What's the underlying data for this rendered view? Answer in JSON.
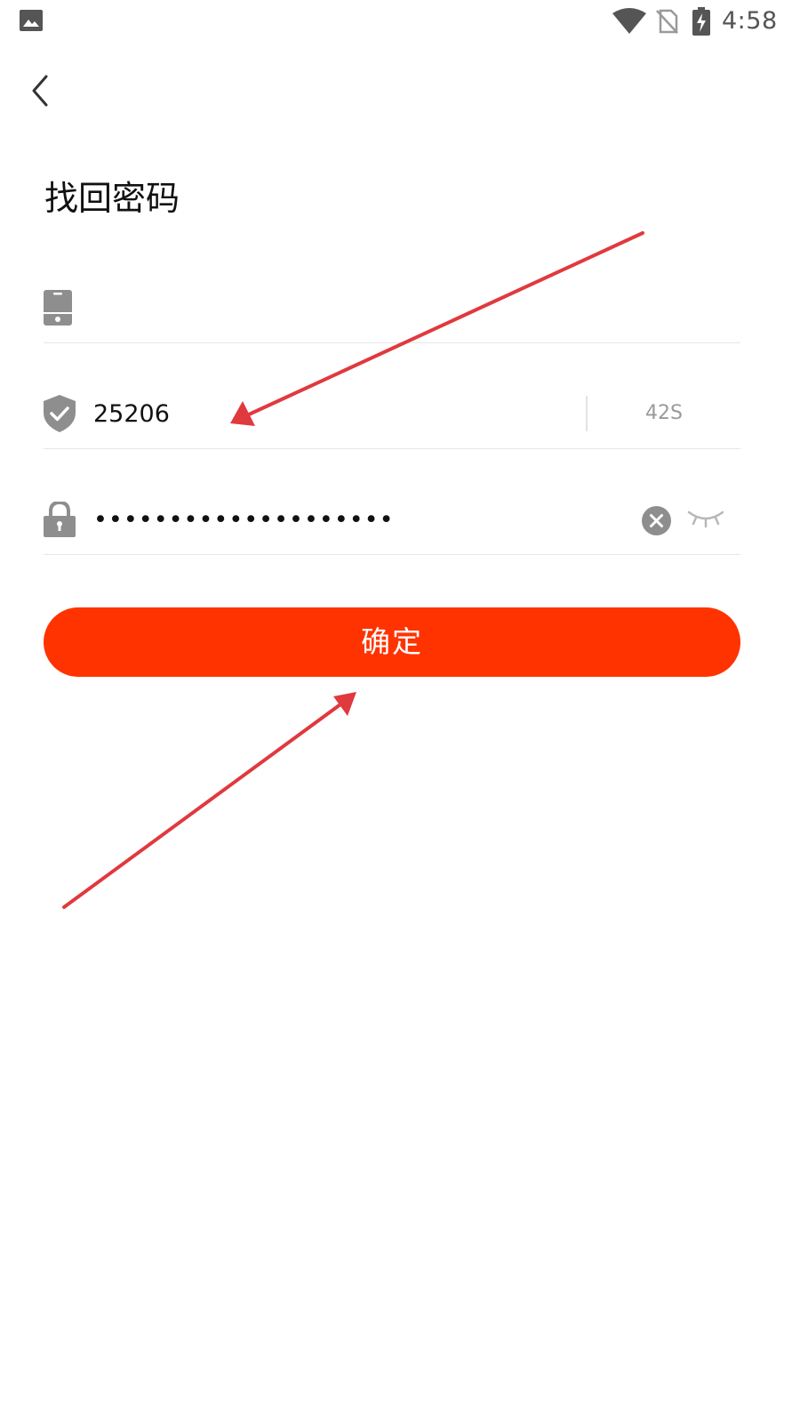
{
  "status_bar": {
    "time": "4:58",
    "icons": [
      "gallery-icon",
      "wifi-icon",
      "no-sim-icon",
      "battery-charging-icon"
    ]
  },
  "header": {
    "back_icon": "chevron-left-icon",
    "title": "找回密码"
  },
  "form": {
    "phone": {
      "icon": "phone-icon",
      "value": "",
      "placeholder": ""
    },
    "verification_code": {
      "icon": "shield-check-icon",
      "value": "25206",
      "countdown": "42S"
    },
    "password": {
      "icon": "lock-icon",
      "value": "••••••••••••••••••••",
      "clear_icon": "clear-icon",
      "visibility_icon": "eye-closed-icon"
    }
  },
  "submit": {
    "label": "确定"
  },
  "colors": {
    "accent": "#ff3300",
    "icon_gray": "#8e8e8e",
    "divider": "#e6e6e6",
    "annotation": "#e0393e"
  }
}
